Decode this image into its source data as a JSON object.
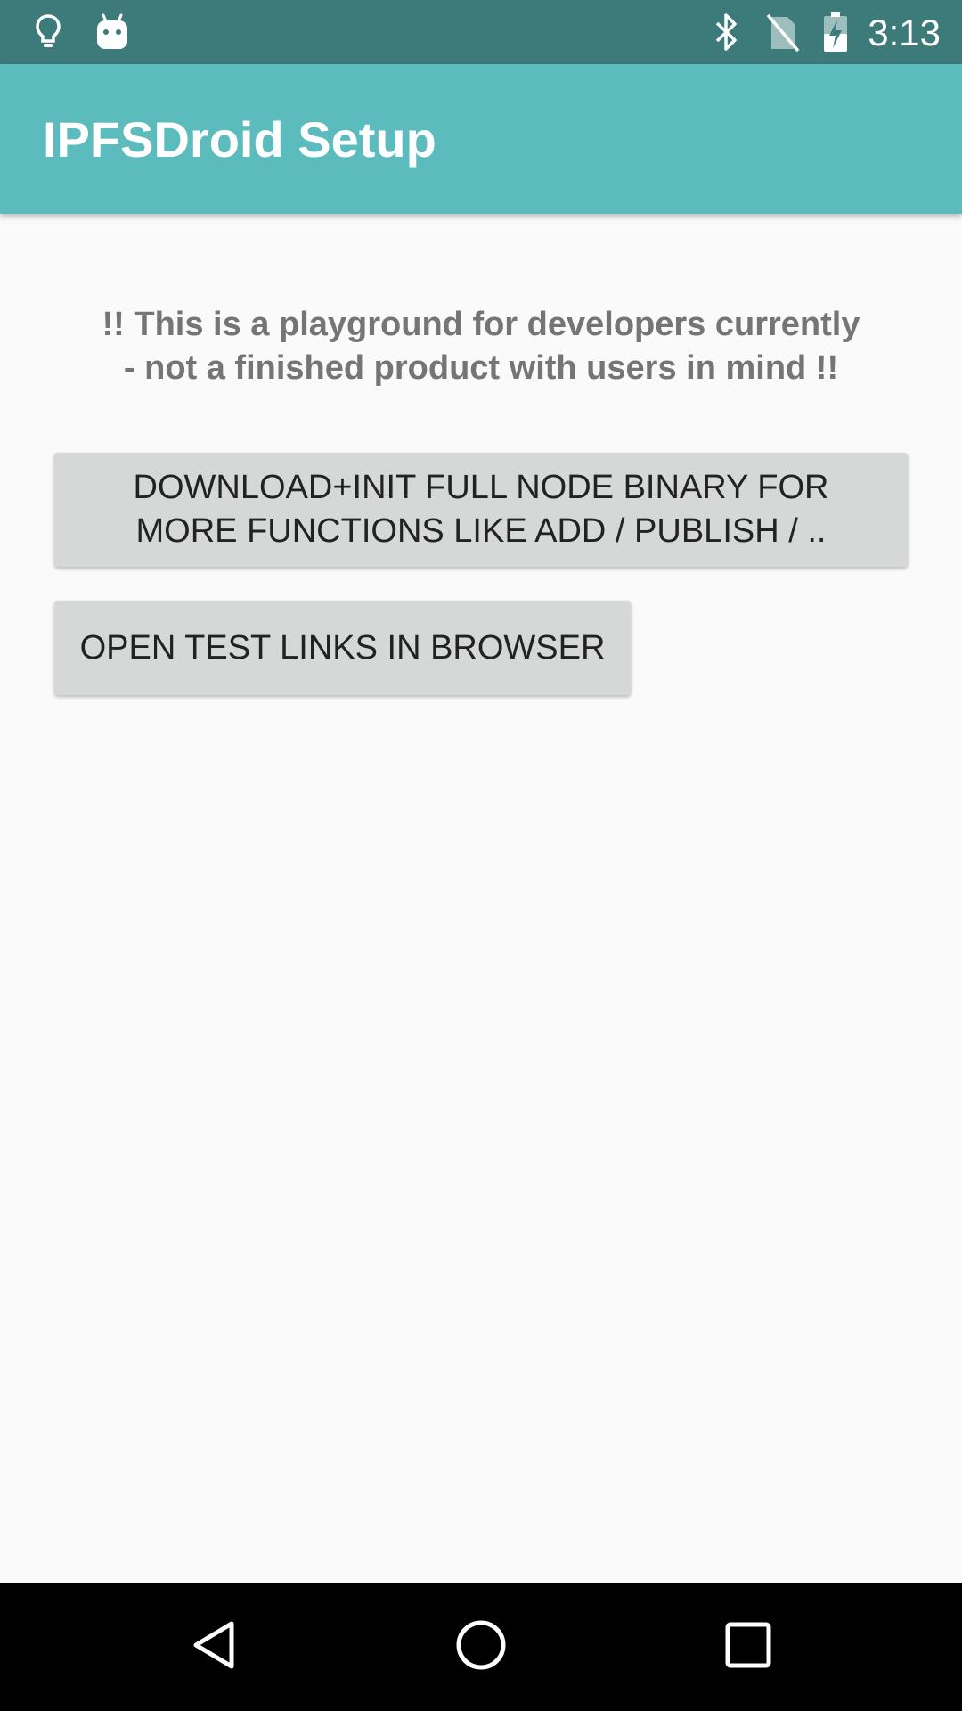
{
  "status_bar": {
    "time": "3:13",
    "background_color": "#3d7a7a",
    "icons": [
      "lightbulb-icon",
      "android-icon",
      "bluetooth-icon",
      "no-sim-icon",
      "battery-charging-icon"
    ]
  },
  "app_bar": {
    "title": "IPFSDroid Setup",
    "background_color": "#5bbbbd"
  },
  "main": {
    "warning_text": "!! This is a playground for developers currently\n- not a finished product with users in mind !!",
    "download_button_label": "DOWNLOAD+INIT FULL NODE BINARY FOR\nMORE FUNCTIONS LIKE ADD / PUBLISH / ..",
    "test_links_button_label": "OPEN TEST LINKS IN BROWSER"
  },
  "nav_bar": {
    "icons": [
      "back-icon",
      "home-icon",
      "recents-icon"
    ]
  }
}
